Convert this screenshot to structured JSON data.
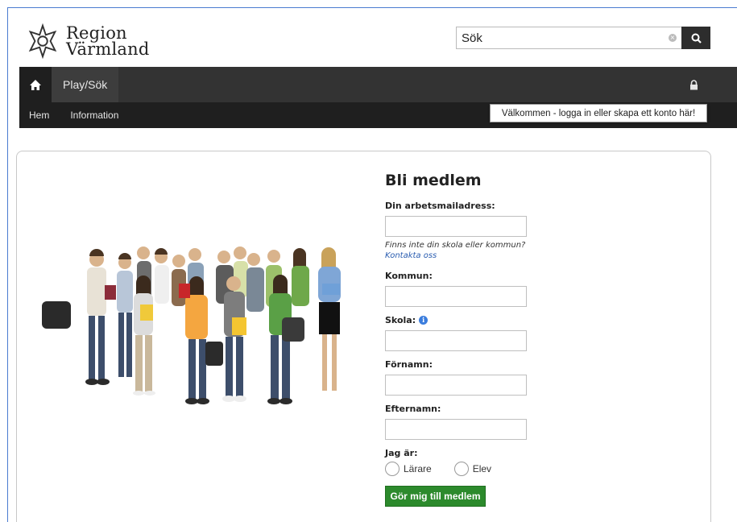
{
  "header": {
    "logo_line1": "Region",
    "logo_line2": "Värmland",
    "search_value": "Sök"
  },
  "nav": {
    "tab": "Play/Sök",
    "sub_items": [
      "Hem",
      "Information"
    ]
  },
  "tooltip": "Välkommen - logga in eller skapa ett konto här!",
  "form": {
    "title": "Bli medlem",
    "email_label": "Din arbetsmailadress:",
    "help_text": "Finns inte din skola eller kommun?",
    "help_link": "Kontakta oss",
    "kommun_label": "Kommun:",
    "skola_label": "Skola:",
    "fornamn_label": "Förnamn:",
    "efternamn_label": "Efternamn:",
    "role_label": "Jag är:",
    "role_options": [
      "Lärare",
      "Elev"
    ],
    "submit_label": "Gör mig till medlem"
  },
  "colors": {
    "nav_bg": "#333333",
    "subnav_bg": "#1f1f1f",
    "submit_bg": "#2c8a2c",
    "link": "#2a5db0"
  }
}
